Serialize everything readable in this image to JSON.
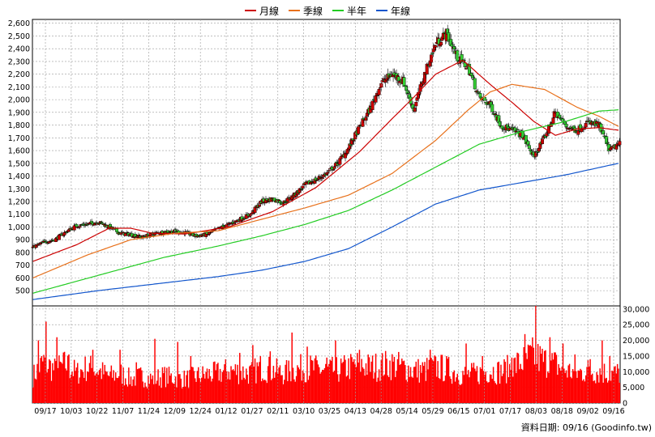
{
  "chart_data": {
    "type": "candlestick",
    "legend": [
      {
        "name": "月線",
        "color": "#cc0000"
      },
      {
        "name": "季線",
        "color": "#e8701a"
      },
      {
        "name": "半年",
        "color": "#22cc22"
      },
      {
        "name": "年線",
        "color": "#1155cc"
      }
    ],
    "price_axis": {
      "ticks": [
        "2,600",
        "2,500",
        "2,400",
        "2,300",
        "2,200",
        "2,100",
        "2,000",
        "1,900",
        "1,800",
        "1,700",
        "1,600",
        "1,500",
        "1,400",
        "1,300",
        "1,200",
        "1,100",
        "1,000",
        "900",
        "800",
        "700",
        "600",
        "500"
      ],
      "ylim": [
        380,
        2630
      ]
    },
    "volume_axis": {
      "ticks": [
        "30,000",
        "25,000",
        "20,000",
        "15,000",
        "10,000",
        "5,000",
        "0"
      ],
      "ylim": [
        0,
        31000
      ]
    },
    "x_labels": [
      "09/17",
      "10/03",
      "10/22",
      "11/07",
      "11/24",
      "12/09",
      "12/24",
      "01/12",
      "01/27",
      "02/11",
      "03/10",
      "03/25",
      "04/13",
      "04/28",
      "05/14",
      "05/29",
      "06/15",
      "07/01",
      "07/17",
      "08/03",
      "08/18",
      "09/02",
      "09/16"
    ],
    "colors": {
      "up": "#cc0000",
      "down": "#33cc33",
      "volume": "#ff0000",
      "grid": "#999999",
      "plot_bg": "#ffffff"
    },
    "close_path": [
      [
        0,
        840
      ],
      [
        10,
        880
      ],
      [
        20,
        900
      ],
      [
        30,
        960
      ],
      [
        40,
        1010
      ],
      [
        50,
        1020
      ],
      [
        60,
        1040
      ],
      [
        70,
        1000
      ],
      [
        80,
        950
      ],
      [
        90,
        940
      ],
      [
        100,
        920
      ],
      [
        110,
        945
      ],
      [
        120,
        960
      ],
      [
        130,
        965
      ],
      [
        140,
        955
      ],
      [
        150,
        930
      ],
      [
        160,
        940
      ],
      [
        170,
        985
      ],
      [
        180,
        1020
      ],
      [
        190,
        1060
      ],
      [
        200,
        1100
      ],
      [
        210,
        1200
      ],
      [
        220,
        1220
      ],
      [
        230,
        1190
      ],
      [
        240,
        1250
      ],
      [
        250,
        1330
      ],
      [
        260,
        1370
      ],
      [
        270,
        1420
      ],
      [
        280,
        1500
      ],
      [
        290,
        1620
      ],
      [
        300,
        1780
      ],
      [
        310,
        1930
      ],
      [
        320,
        2130
      ],
      [
        330,
        2200
      ],
      [
        340,
        2150
      ],
      [
        350,
        1920
      ],
      [
        360,
        2200
      ],
      [
        370,
        2440
      ],
      [
        380,
        2520
      ],
      [
        390,
        2330
      ],
      [
        400,
        2250
      ],
      [
        410,
        2020
      ],
      [
        420,
        1960
      ],
      [
        430,
        1800
      ],
      [
        440,
        1760
      ],
      [
        450,
        1720
      ],
      [
        460,
        1550
      ],
      [
        470,
        1700
      ],
      [
        480,
        1900
      ],
      [
        490,
        1790
      ],
      [
        500,
        1760
      ],
      [
        510,
        1820
      ],
      [
        520,
        1800
      ],
      [
        530,
        1600
      ],
      [
        538,
        1650
      ]
    ],
    "ma_paths": {
      "月線": [
        [
          0,
          730
        ],
        [
          40,
          860
        ],
        [
          70,
          990
        ],
        [
          90,
          990
        ],
        [
          110,
          950
        ],
        [
          140,
          945
        ],
        [
          180,
          1000
        ],
        [
          220,
          1120
        ],
        [
          260,
          1310
        ],
        [
          300,
          1590
        ],
        [
          330,
          1850
        ],
        [
          350,
          2020
        ],
        [
          370,
          2200
        ],
        [
          395,
          2310
        ],
        [
          420,
          2120
        ],
        [
          440,
          1980
        ],
        [
          460,
          1830
        ],
        [
          480,
          1720
        ],
        [
          500,
          1770
        ],
        [
          520,
          1780
        ],
        [
          538,
          1760
        ]
      ],
      "季線": [
        [
          0,
          600
        ],
        [
          50,
          780
        ],
        [
          90,
          900
        ],
        [
          130,
          950
        ],
        [
          170,
          970
        ],
        [
          210,
          1060
        ],
        [
          250,
          1150
        ],
        [
          290,
          1250
        ],
        [
          330,
          1420
        ],
        [
          370,
          1680
        ],
        [
          400,
          1920
        ],
        [
          420,
          2060
        ],
        [
          440,
          2120
        ],
        [
          470,
          2080
        ],
        [
          500,
          1940
        ],
        [
          520,
          1870
        ],
        [
          538,
          1790
        ]
      ],
      "半年": [
        [
          0,
          480
        ],
        [
          60,
          620
        ],
        [
          120,
          760
        ],
        [
          170,
          850
        ],
        [
          210,
          930
        ],
        [
          250,
          1020
        ],
        [
          290,
          1130
        ],
        [
          330,
          1290
        ],
        [
          370,
          1470
        ],
        [
          410,
          1650
        ],
        [
          450,
          1750
        ],
        [
          490,
          1830
        ],
        [
          520,
          1910
        ],
        [
          538,
          1920
        ]
      ],
      "年線": [
        [
          0,
          430
        ],
        [
          60,
          500
        ],
        [
          120,
          560
        ],
        [
          170,
          610
        ],
        [
          210,
          660
        ],
        [
          250,
          730
        ],
        [
          290,
          830
        ],
        [
          330,
          1000
        ],
        [
          370,
          1180
        ],
        [
          410,
          1290
        ],
        [
          450,
          1350
        ],
        [
          490,
          1410
        ],
        [
          538,
          1500
        ]
      ]
    },
    "volume_profile": [
      [
        0,
        9000
      ],
      [
        10,
        14000
      ],
      [
        20,
        11000
      ],
      [
        30,
        13000
      ],
      [
        40,
        10000
      ],
      [
        50,
        12000
      ],
      [
        60,
        11000
      ],
      [
        70,
        9000
      ],
      [
        80,
        10000
      ],
      [
        90,
        8000
      ],
      [
        100,
        9000
      ],
      [
        110,
        8000
      ],
      [
        120,
        9000
      ],
      [
        130,
        8500
      ],
      [
        140,
        8000
      ],
      [
        150,
        9000
      ],
      [
        160,
        9500
      ],
      [
        170,
        10000
      ],
      [
        180,
        11000
      ],
      [
        190,
        10500
      ],
      [
        200,
        10000
      ],
      [
        210,
        12000
      ],
      [
        220,
        11000
      ],
      [
        230,
        10000
      ],
      [
        240,
        11000
      ],
      [
        250,
        12000
      ],
      [
        260,
        11500
      ],
      [
        270,
        11000
      ],
      [
        280,
        11000
      ],
      [
        290,
        12000
      ],
      [
        300,
        13000
      ],
      [
        310,
        12000
      ],
      [
        320,
        12500
      ],
      [
        330,
        13000
      ],
      [
        340,
        12000
      ],
      [
        350,
        11000
      ],
      [
        360,
        11000
      ],
      [
        370,
        12000
      ],
      [
        380,
        11500
      ],
      [
        390,
        10000
      ],
      [
        400,
        9500
      ],
      [
        410,
        10000
      ],
      [
        420,
        11000
      ],
      [
        430,
        10500
      ],
      [
        440,
        12000
      ],
      [
        450,
        14000
      ],
      [
        460,
        16000
      ],
      [
        470,
        14000
      ],
      [
        480,
        13000
      ],
      [
        490,
        11000
      ],
      [
        500,
        10000
      ],
      [
        510,
        11000
      ],
      [
        520,
        10500
      ],
      [
        530,
        10000
      ],
      [
        538,
        10000
      ]
    ],
    "volume_peaks": [
      [
        5,
        20000
      ],
      [
        12,
        26000
      ],
      [
        22,
        21000
      ],
      [
        33,
        15500
      ],
      [
        55,
        17000
      ],
      [
        80,
        17000
      ],
      [
        95,
        13000
      ],
      [
        112,
        20500
      ],
      [
        133,
        19500
      ],
      [
        145,
        15000
      ],
      [
        160,
        11000
      ],
      [
        190,
        16000
      ],
      [
        202,
        18500
      ],
      [
        218,
        16500
      ],
      [
        238,
        22500
      ],
      [
        252,
        18000
      ],
      [
        270,
        14500
      ],
      [
        278,
        20000
      ],
      [
        300,
        17000
      ],
      [
        335,
        14000
      ],
      [
        365,
        17000
      ],
      [
        398,
        19000
      ],
      [
        413,
        15000
      ],
      [
        440,
        14500
      ],
      [
        452,
        22000
      ],
      [
        462,
        31000
      ],
      [
        475,
        21000
      ],
      [
        487,
        19000
      ],
      [
        498,
        15500
      ],
      [
        512,
        14000
      ],
      [
        523,
        20000
      ],
      [
        530,
        15000
      ]
    ]
  },
  "footer": {
    "note": "資料日期: 09/16  (Goodinfo.tw)"
  }
}
